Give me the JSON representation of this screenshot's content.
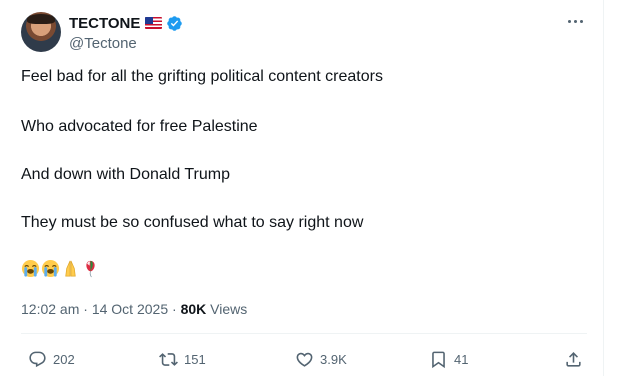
{
  "author": {
    "display_name": "TECTONE",
    "handle": "@Tectone",
    "flag_icon": "us-flag-icon",
    "verified_color": "#1d9bf0"
  },
  "post": {
    "lines": [
      "Feel bad for all the grifting political content creators",
      "Who advocated for free Palestine",
      "And down with Donald Trump",
      "They must be so confused what to say right now"
    ],
    "emojis": [
      "loudly-crying-face",
      "loudly-crying-face",
      "folded-hands",
      "balloon"
    ]
  },
  "meta": {
    "time": "12:02 am",
    "separator": "·",
    "date": "14 Oct 2025",
    "views_count": "80K",
    "views_label": "Views"
  },
  "actions": {
    "replies": "202",
    "reposts": "151",
    "likes": "3.9K",
    "bookmarks": "41"
  },
  "colors": {
    "text": "#0f1419",
    "muted": "#536471",
    "accent": "#1d9bf0"
  }
}
